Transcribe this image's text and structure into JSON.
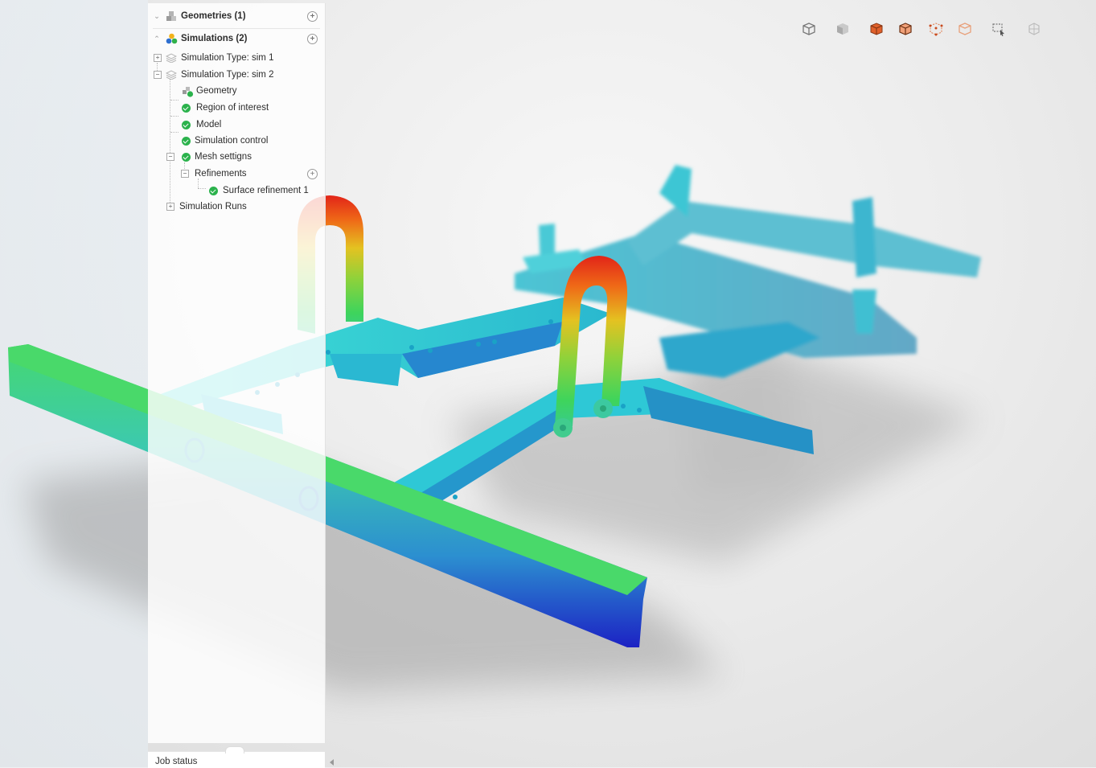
{
  "tree": {
    "geometries": {
      "label": "Geometries (1)",
      "icon": "geometry-icon"
    },
    "simulations": {
      "label": "Simulations (2)",
      "icon": "simulations-icon"
    },
    "sim1": {
      "label": "Simulation Type: sim 1",
      "expander": "+"
    },
    "sim2": {
      "label": "Simulation Type: sim 2",
      "expander": "−"
    },
    "geometry": {
      "label": "Geometry"
    },
    "region_of_interest": {
      "label": "Region of interest"
    },
    "model": {
      "label": "Model"
    },
    "simulation_control": {
      "label": "Simulation control"
    },
    "mesh_settings": {
      "label": "Mesh settigns",
      "expander": "−"
    },
    "refinements": {
      "label": "Refinements",
      "expander": "−"
    },
    "surface_refinement": {
      "label": "Surface refinement 1"
    },
    "simulation_runs": {
      "label": "Simulation Runs",
      "expander": "+"
    }
  },
  "job_status": {
    "label": "Job status"
  },
  "toolbar": {
    "buttons": [
      "view-cube-icon",
      "solid-view-icon",
      "surface-view-icon",
      "wireframe-surface-icon",
      "points-view-icon",
      "outline-view-icon",
      "box-select-icon",
      "settings-cube-icon"
    ]
  },
  "colors": {
    "check_green": "#2bb24c",
    "result_red": "#e0201a",
    "result_green": "#44d46a",
    "result_cyan": "#33c8d6",
    "result_blue": "#1d27c8"
  }
}
